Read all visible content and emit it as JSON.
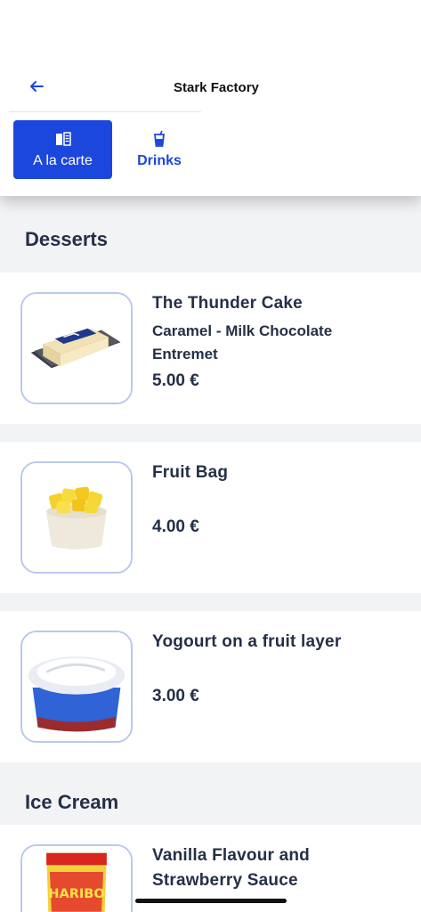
{
  "header": {
    "title": "Stark Factory",
    "back_icon": "arrow-left-icon"
  },
  "tabs": [
    {
      "label": "A la carte",
      "icon": "menu-book-icon",
      "active": true
    },
    {
      "label": "Drinks",
      "icon": "drink-cup-icon",
      "active": false
    }
  ],
  "sections": [
    {
      "title": "Desserts",
      "items": [
        {
          "name": "The Thunder Cake",
          "desc_line1": "Caramel - Milk Chocolate",
          "desc_line2": "Entremet",
          "price": "5.00 €"
        },
        {
          "name": "Fruit Bag",
          "price": "4.00 €"
        },
        {
          "name": "Yogourt on a fruit layer",
          "price": "3.00 €"
        }
      ]
    },
    {
      "title": "Ice Cream",
      "items": [
        {
          "name_line1": "Vanilla Flavour and",
          "name_line2": "Strawberry Sauce",
          "package_text": "HARIBO"
        }
      ]
    }
  ],
  "colors": {
    "accent": "#1c47dd",
    "text": "#243047",
    "background": "#f2f3f5",
    "thumb_border": "#b9c8ef"
  }
}
